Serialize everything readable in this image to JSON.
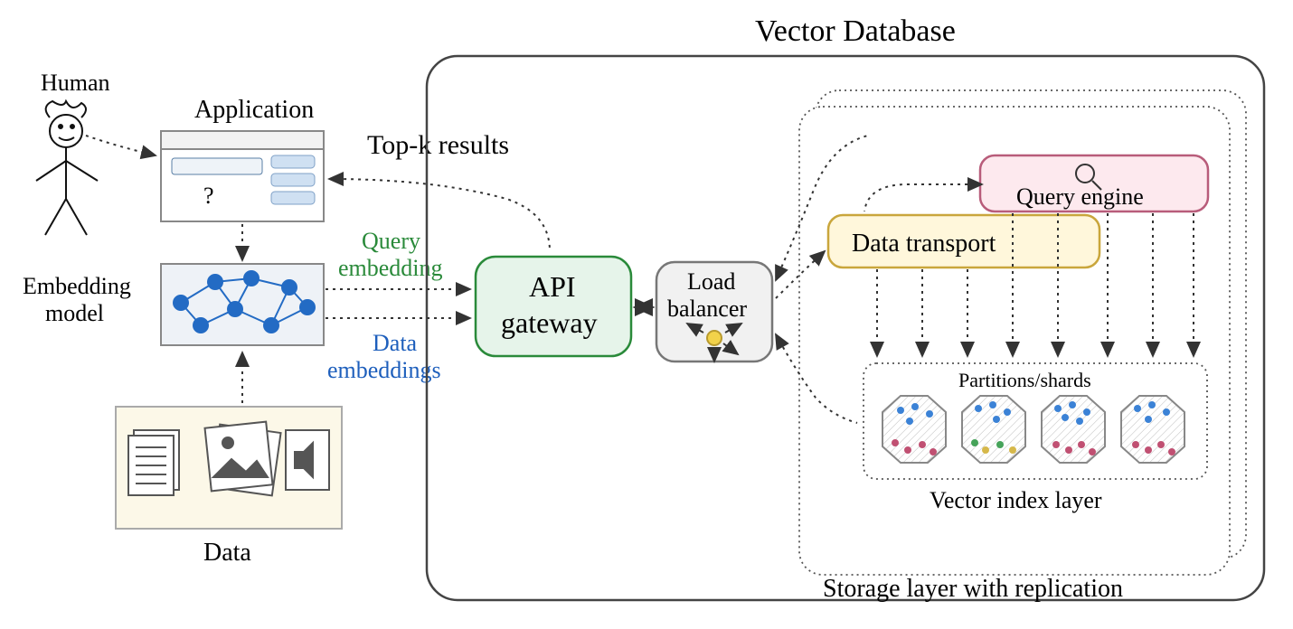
{
  "labels": {
    "human": "Human",
    "application": "Application",
    "question": "?",
    "embedding_model_l1": "Embedding",
    "embedding_model_l2": "model",
    "data": "Data",
    "topk": "Top-k results",
    "query_emb_l1": "Query",
    "query_emb_l2": "embedding",
    "data_emb_l1": "Data",
    "data_emb_l2": "embeddings",
    "api_gw_l1": "API",
    "api_gw_l2": "gateway",
    "load_bal_l1": "Load",
    "load_bal_l2": "balancer",
    "vector_db": "Vector Database",
    "query_engine": "Query engine",
    "data_transport": "Data transport",
    "partitions": "Partitions/shards",
    "vector_index": "Vector index layer",
    "storage_layer": "Storage layer with replication"
  },
  "colors": {
    "green": "#2a8a3a",
    "blue": "#1e5fbc",
    "api_fill": "#e6f4ea",
    "api_stroke": "#2a8a3a",
    "lb_fill": "#f1f1f1",
    "lb_stroke": "#777",
    "qe_fill": "#fde9ee",
    "qe_stroke": "#b85c7a",
    "dt_fill": "#fff7db",
    "dt_stroke": "#c9a63c",
    "emb_fill": "#eef2f7",
    "data_fill": "#fcf8e8",
    "node_blue": "#236bc4"
  }
}
